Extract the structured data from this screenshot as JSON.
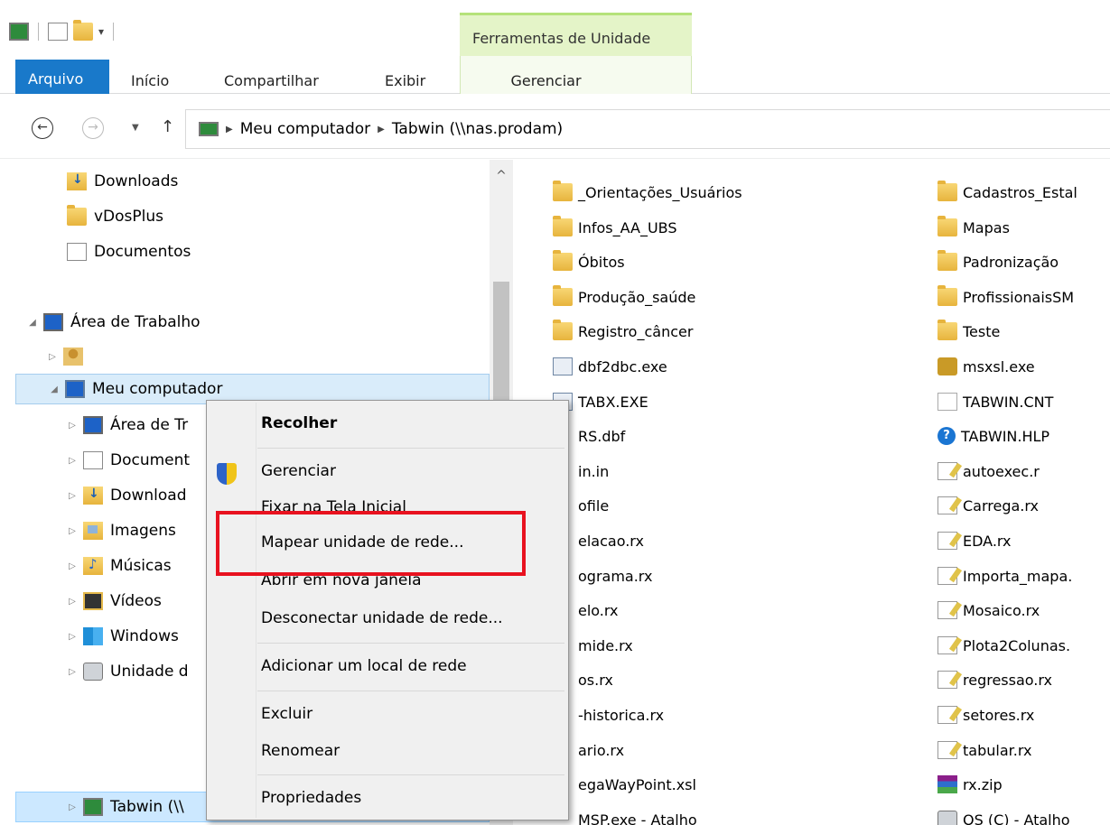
{
  "ribbon": {
    "context_tab_title": "Ferramentas de Unidade",
    "tabs": [
      {
        "label": "Arquivo"
      },
      {
        "label": "Início"
      },
      {
        "label": "Compartilhar"
      },
      {
        "label": "Exibir"
      },
      {
        "label": "Gerenciar"
      }
    ]
  },
  "address": {
    "crumbs": [
      "Meu computador",
      "Tabwin (\\\\nas.prodam)"
    ]
  },
  "navpane": {
    "items": [
      {
        "label": "Downloads",
        "icon": "download-folder-icon"
      },
      {
        "label": "vDosPlus",
        "icon": "folder-icon"
      },
      {
        "label": "Documentos",
        "icon": "document-icon"
      },
      {
        "label": "Área de Trabalho",
        "icon": "desktop-icon"
      },
      {
        "label": "",
        "icon": "user-folder-icon"
      },
      {
        "label": "Meu computador",
        "icon": "computer-icon"
      },
      {
        "label": "Área de Tr",
        "icon": "desktop-folder-icon"
      },
      {
        "label": "Document",
        "icon": "documents-folder-icon"
      },
      {
        "label": "Download",
        "icon": "download-folder-icon"
      },
      {
        "label": "Imagens",
        "icon": "pictures-folder-icon"
      },
      {
        "label": "Músicas",
        "icon": "music-folder-icon"
      },
      {
        "label": "Vídeos",
        "icon": "videos-folder-icon"
      },
      {
        "label": "Windows",
        "icon": "windows-drive-icon"
      },
      {
        "label": "Unidade d",
        "icon": "drive-icon"
      },
      {
        "label": "Tabwin (\\\\",
        "icon": "network-drive-icon"
      }
    ]
  },
  "files": {
    "col1": [
      {
        "name": "_Orientações_Usuários",
        "icon": "folder-icon"
      },
      {
        "name": "Infos_AA_UBS",
        "icon": "folder-icon"
      },
      {
        "name": "Óbitos",
        "icon": "folder-icon"
      },
      {
        "name": "Produção_saúde",
        "icon": "folder-icon"
      },
      {
        "name": "Registro_câncer",
        "icon": "folder-icon"
      },
      {
        "name": "dbf2dbc.exe",
        "icon": "exe-icon"
      },
      {
        "name": "TABX.EXE",
        "icon": "exe-icon"
      },
      {
        "name": "RS.dbf",
        "icon": ""
      },
      {
        "name": "in.in",
        "icon": ""
      },
      {
        "name": "ofile",
        "icon": ""
      },
      {
        "name": "elacao.rx",
        "icon": ""
      },
      {
        "name": "ograma.rx",
        "icon": ""
      },
      {
        "name": "elo.rx",
        "icon": ""
      },
      {
        "name": "mide.rx",
        "icon": ""
      },
      {
        "name": "os.rx",
        "icon": ""
      },
      {
        "name": "-historica.rx",
        "icon": ""
      },
      {
        "name": "ario.rx",
        "icon": ""
      },
      {
        "name": "egaWayPoint.xsl",
        "icon": ""
      },
      {
        "name": "MSP.exe - Atalho",
        "icon": ""
      }
    ],
    "col2": [
      {
        "name": "Cadastros_Estal",
        "icon": "folder-icon"
      },
      {
        "name": "Mapas",
        "icon": "folder-icon"
      },
      {
        "name": "Padronização",
        "icon": "folder-icon"
      },
      {
        "name": "ProfissionaisSM",
        "icon": "folder-icon"
      },
      {
        "name": "Teste",
        "icon": "folder-icon"
      },
      {
        "name": "msxsl.exe",
        "icon": "msxsl-icon"
      },
      {
        "name": "TABWIN.CNT",
        "icon": "blank-file-icon"
      },
      {
        "name": "TABWIN.HLP",
        "icon": "help-file-icon"
      },
      {
        "name": "autoexec.r",
        "icon": "script-file-icon"
      },
      {
        "name": "Carrega.rx",
        "icon": "script-file-icon"
      },
      {
        "name": "EDA.rx",
        "icon": "script-file-icon"
      },
      {
        "name": "Importa_mapa.",
        "icon": "script-file-icon"
      },
      {
        "name": "Mosaico.rx",
        "icon": "script-file-icon"
      },
      {
        "name": "Plota2Colunas.",
        "icon": "script-file-icon"
      },
      {
        "name": "regressao.rx",
        "icon": "script-file-icon"
      },
      {
        "name": "setores.rx",
        "icon": "script-file-icon"
      },
      {
        "name": "tabular.rx",
        "icon": "script-file-icon"
      },
      {
        "name": "rx.zip",
        "icon": "zip-file-icon"
      },
      {
        "name": "OS (C) - Atalho",
        "icon": "shortcut-icon"
      }
    ]
  },
  "context_menu": {
    "items": [
      {
        "label": "Recolher"
      },
      {
        "label": "Gerenciar"
      },
      {
        "label": "Fixar na Tela Inicial"
      },
      {
        "label": "Mapear unidade de rede..."
      },
      {
        "label": "Abrir em nova janela"
      },
      {
        "label": "Desconectar unidade de rede..."
      },
      {
        "label": "Adicionar um local de rede"
      },
      {
        "label": "Excluir"
      },
      {
        "label": "Renomear"
      },
      {
        "label": "Propriedades"
      }
    ]
  },
  "colors": {
    "file_tab": "#1979ca",
    "context_tab": "#e4f4c8",
    "selection": "#cce8ff",
    "highlight": "#e8121f"
  }
}
